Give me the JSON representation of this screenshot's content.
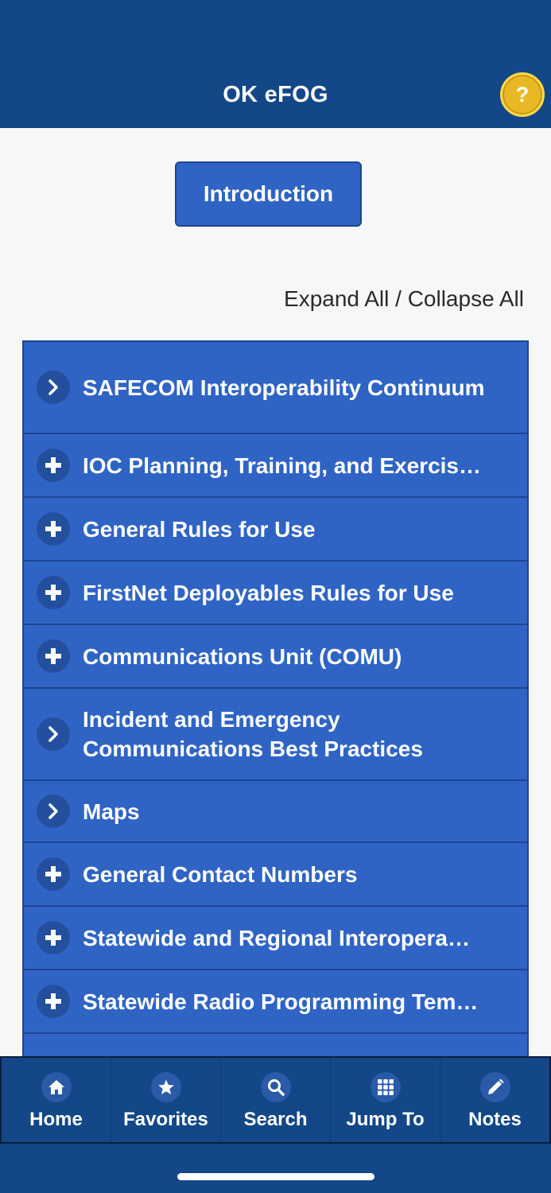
{
  "header": {
    "title": "OK eFOG",
    "help_glyph": "?",
    "help_icon": "help-circle-icon",
    "help_color": "#e8b924",
    "bar_color": "#134787"
  },
  "intro_button": {
    "label": "Introduction"
  },
  "expand_collapse": {
    "expand_label": "Expand All",
    "separator": " / ",
    "collapse_label": "Collapse All"
  },
  "sections": [
    {
      "label": "SAFECOM Interoperability Continuum",
      "icon": "chevron-right-icon"
    },
    {
      "label": "IOC Planning, Training, and Exercis…",
      "icon": "plus-icon"
    },
    {
      "label": "General Rules for Use",
      "icon": "plus-icon"
    },
    {
      "label": "FirstNet Deployables Rules for Use",
      "icon": "plus-icon"
    },
    {
      "label": "Communications Unit (COMU)",
      "icon": "plus-icon"
    },
    {
      "label": "Incident and Emergency Communications Best Practices",
      "icon": "chevron-right-icon"
    },
    {
      "label": "Maps",
      "icon": "chevron-right-icon"
    },
    {
      "label": "General Contact Numbers",
      "icon": "plus-icon"
    },
    {
      "label": "Statewide and Regional Interopera…",
      "icon": "plus-icon"
    },
    {
      "label": "Statewide Radio Programming Tem…",
      "icon": "plus-icon"
    }
  ],
  "tabbar": {
    "tabs": [
      {
        "label": "Home",
        "icon": "home-icon"
      },
      {
        "label": "Favorites",
        "icon": "star-icon"
      },
      {
        "label": "Search",
        "icon": "search-icon"
      },
      {
        "label": "Jump To",
        "icon": "grid-icon"
      },
      {
        "label": "Notes",
        "icon": "pencil-icon"
      }
    ]
  },
  "colors": {
    "accent": "#2f64c5",
    "accent_border": "#1d4592",
    "background": "#f7f7f7"
  }
}
